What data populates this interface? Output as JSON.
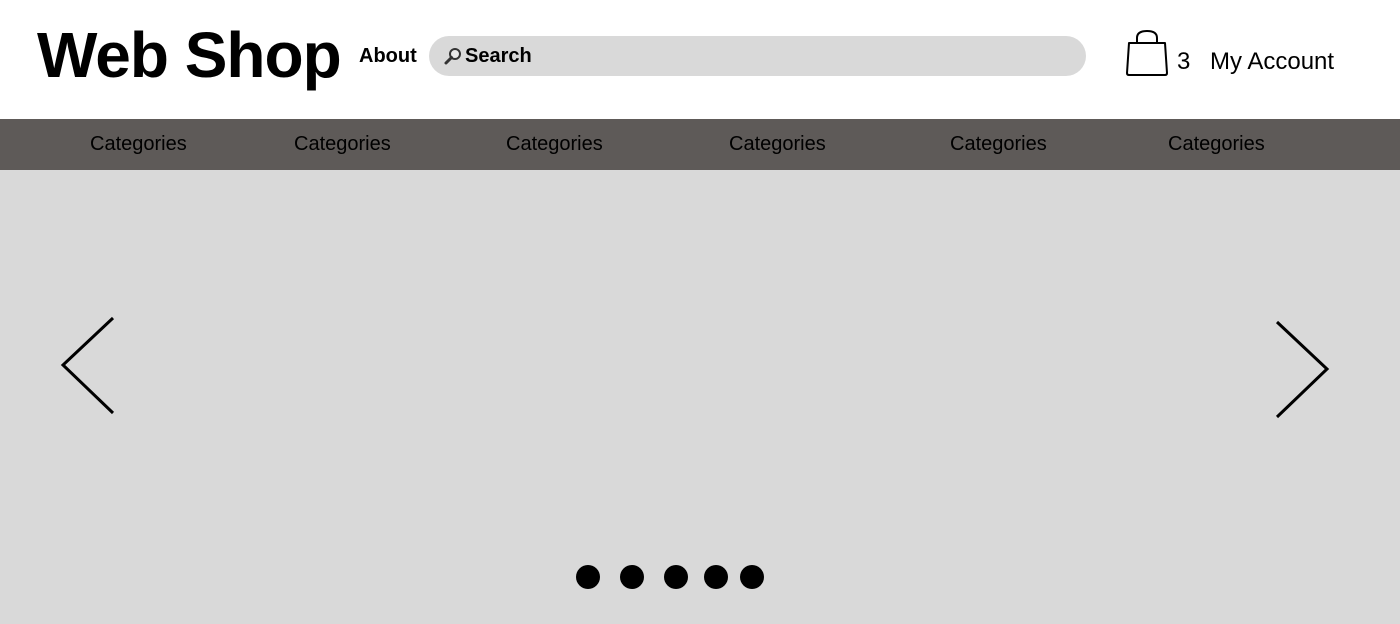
{
  "header": {
    "logo": "Web Shop",
    "about_label": "About",
    "search": {
      "placeholder": "Search",
      "value": ""
    },
    "cart": {
      "icon": "shopping-bag-icon",
      "count": "3"
    },
    "account_label": "My Account"
  },
  "nav": {
    "items": [
      {
        "label": "Categories"
      },
      {
        "label": "Categories"
      },
      {
        "label": "Categories"
      },
      {
        "label": "Categories"
      },
      {
        "label": "Categories"
      },
      {
        "label": "Categories"
      }
    ]
  },
  "carousel": {
    "prev_icon": "chevron-left-icon",
    "next_icon": "chevron-right-icon",
    "slide_count": 5
  },
  "colors": {
    "header_bg": "#ffffff",
    "nav_bg": "#5e5a58",
    "hero_bg": "#d9d9d9",
    "search_bg": "#d9d9d9"
  }
}
